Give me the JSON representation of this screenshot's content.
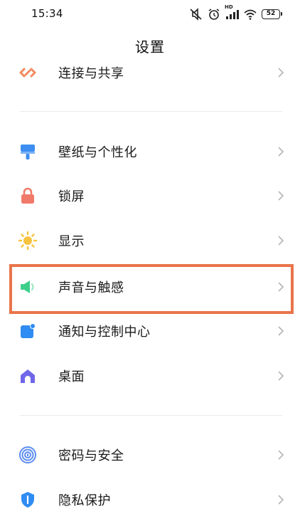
{
  "status_bar": {
    "time": "15:34",
    "battery": "52",
    "network_badge": "HD",
    "icons": [
      "mute-vibrate-icon",
      "alarm-icon",
      "signal-icon",
      "wifi-icon",
      "battery-icon"
    ]
  },
  "header": {
    "title": "设置"
  },
  "settings": {
    "items": [
      {
        "label": "连接与共享",
        "icon": "connection-share-icon",
        "color": "#f08a5d"
      },
      {
        "label": "壁纸与个性化",
        "icon": "wallpaper-brush-icon",
        "color": "#3d8ef0"
      },
      {
        "label": "锁屏",
        "icon": "lock-icon",
        "color": "#f07a6a"
      },
      {
        "label": "显示",
        "icon": "sun-icon",
        "color": "#f8c340"
      },
      {
        "label": "声音与触感",
        "icon": "speaker-icon",
        "color": "#3dcf8a"
      },
      {
        "label": "通知与控制中心",
        "icon": "notification-icon",
        "color": "#2f8cf2"
      },
      {
        "label": "桌面",
        "icon": "home-icon",
        "color": "#6f67e8"
      },
      {
        "label": "密码与安全",
        "icon": "fingerprint-icon",
        "color": "#5b8cf0"
      },
      {
        "label": "隐私保护",
        "icon": "privacy-shield-icon",
        "color": "#2f8cf2"
      }
    ]
  },
  "colors": {
    "highlight_border": "#e8744a",
    "chevron": "#b5b5b5",
    "divider": "#ececec"
  }
}
